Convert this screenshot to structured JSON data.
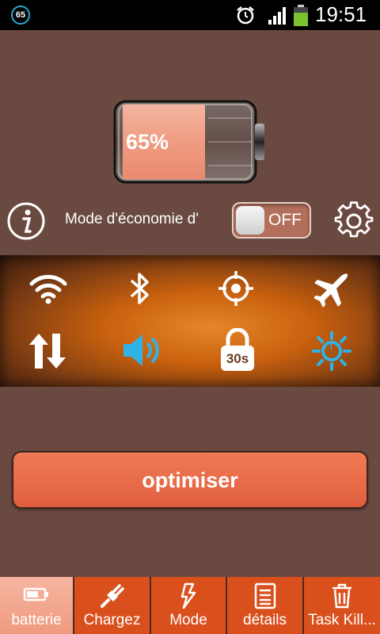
{
  "status_bar": {
    "badge": "65",
    "time": "19:51",
    "icons": [
      "alarm-icon",
      "signal-icon",
      "battery-icon"
    ]
  },
  "battery": {
    "percent_label": "65%",
    "level": 0.65
  },
  "mode": {
    "label": "Mode d'économie d'",
    "toggle_label": "OFF",
    "toggle_on": false
  },
  "quick_settings": {
    "icons": [
      "wifi-icon",
      "bluetooth-icon",
      "gps-icon",
      "airplane-icon",
      "mobile-data-icon",
      "volume-icon",
      "screen-timeout-icon",
      "brightness-icon"
    ],
    "timeout_label": "30s"
  },
  "optimize_label": "optimiser",
  "tabs": [
    {
      "label": "batterie",
      "icon": "battery-icon"
    },
    {
      "label": "Chargez",
      "icon": "plug-icon"
    },
    {
      "label": "Mode",
      "icon": "lightning-icon"
    },
    {
      "label": "détails",
      "icon": "list-icon"
    },
    {
      "label": "Task Kill...",
      "icon": "trash-icon"
    }
  ],
  "colors": {
    "background": "#6a4a40",
    "accent": "#e86a48",
    "tab_active": "#ef9a80",
    "tab_inactive": "#d9501d",
    "highlight_icon": "#2fb3e6"
  }
}
